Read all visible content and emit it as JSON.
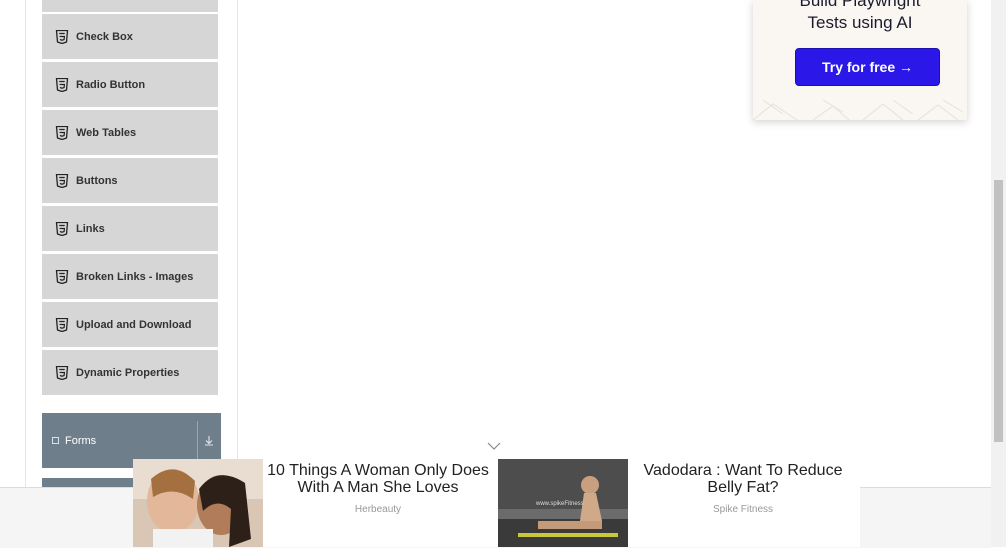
{
  "sidebar": {
    "items": [
      {
        "label": ""
      },
      {
        "label": "Check Box"
      },
      {
        "label": "Radio Button"
      },
      {
        "label": "Web Tables"
      },
      {
        "label": "Buttons"
      },
      {
        "label": "Links"
      },
      {
        "label": "Broken Links - Images"
      },
      {
        "label": "Upload and Download"
      },
      {
        "label": "Dynamic Properties"
      }
    ],
    "group": {
      "label": "Forms",
      "icon": "document-icon",
      "toggle_icon": "chevron-down-icon"
    }
  },
  "promo": {
    "title_line1": "Build Playwright",
    "title_line2": "Tests using AI",
    "button_label": "Try for free →",
    "accent": "#2a17e8"
  },
  "ads": [
    {
      "headline": "10 Things A Woman Only Does With A Man She Loves",
      "source": "Herbeauty"
    },
    {
      "headline": "Vadodara : Want To Reduce Belly Fat?",
      "source": "Spike Fitness"
    }
  ],
  "colors": {
    "menu_item_bg": "#d6d6d6",
    "group_bg": "#6f7e8b",
    "button_bg": "#2a17e8"
  }
}
